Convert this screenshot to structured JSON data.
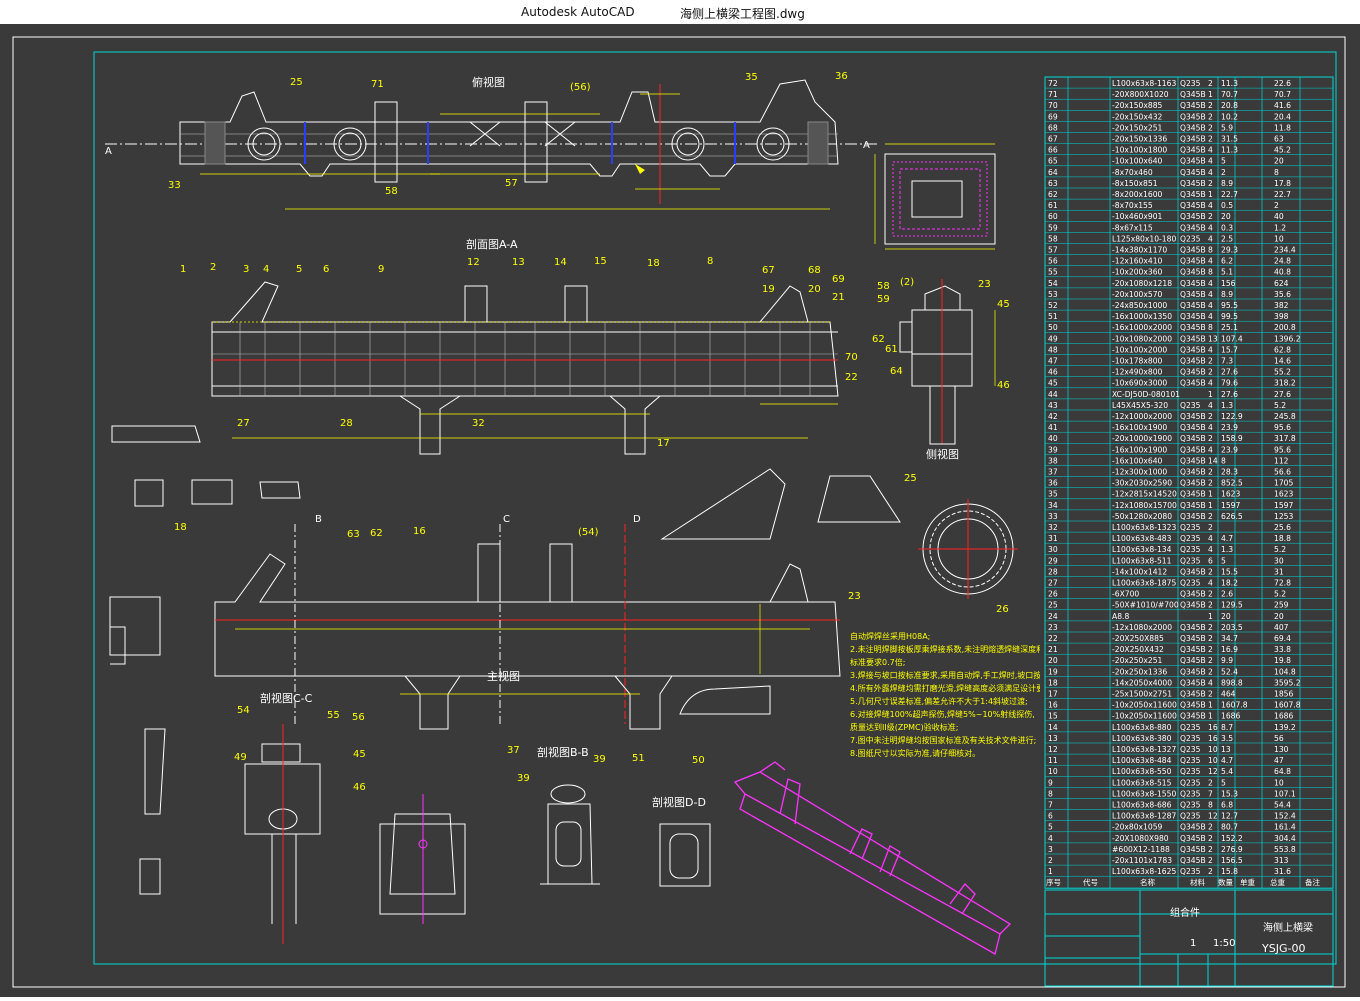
{
  "titlebar": {
    "app": "Autodesk AutoCAD",
    "file": "海侧上横梁工程图.dwg"
  },
  "colors": {
    "background": "#3a3a3a",
    "frame": "#00d8d8",
    "lines": "#ffffff",
    "dims": "#ffff00",
    "leaders": "#19e619",
    "centerline": "#ff2222",
    "hidden": "#2a3cff",
    "iso": "#ff33ff"
  },
  "views": {
    "top": "俯视图",
    "sectionAA": "剖面图A-A",
    "side": "侧视图",
    "front": "主视图",
    "sectionCC": "剖视图C-C",
    "sectionBB": "剖视图B-B",
    "sectionDD": "剖视图D-D"
  },
  "section_letters": [
    "A",
    "A",
    "B",
    "C",
    "D"
  ],
  "top_balloons": [
    "25",
    "71",
    "(56)",
    "35",
    "36",
    "33",
    "58",
    "57"
  ],
  "aa_balloons": [
    "1",
    "2",
    "3",
    "4",
    "5",
    "6",
    "9",
    "12",
    "13",
    "14",
    "15",
    "18",
    "8",
    "67",
    "68",
    "69",
    "19",
    "20",
    "21",
    "70",
    "22",
    "27",
    "28",
    "32",
    "17"
  ],
  "side_balloons": [
    "58",
    "59",
    "61",
    "62",
    "64",
    "(2)",
    "23",
    "45",
    "46"
  ],
  "front_balloons": [
    "18",
    "63",
    "62",
    "16",
    "(54)",
    "23"
  ],
  "misc_balloons": [
    "25",
    "26",
    "54",
    "55",
    "56",
    "49",
    "45",
    "46",
    "37",
    "39",
    "39",
    "51",
    "50"
  ],
  "notes": [
    "自动焊焊丝采用H08A;",
    "2.未注明焊脚按板厚乘焊接系数,未注明熔透焊缝深度和坡口角度按",
    "   标准要求0.7倍;",
    "3.焊接与坡口按标准要求,采用自动焊,手工焊时,坡口按厂标规定;",
    "4.所有外露焊缝均需打磨光滑,焊缝高度必须满足设计要求;",
    "5.几何尺寸误差标准,偏差允许不大于1:4斜坡过渡;",
    "6.对接焊缝100%超声探伤,焊缝5%~10%射线探伤,",
    "   质量达到II级(ZPMC)验收标准;",
    "7.图中未注明焊缝均按国家标准及有关技术文件进行;",
    "8.图纸尺寸以实际为准,请仔细核对。"
  ],
  "bom": [
    [
      "72",
      "L100x63x8-1163",
      "Q235",
      "2",
      "11.3",
      "22.6"
    ],
    [
      "71",
      "-20X800X1020",
      "Q345B",
      "1",
      "70.7",
      "70.7"
    ],
    [
      "70",
      "-20x150x885",
      "Q345B",
      "2",
      "20.8",
      "41.6"
    ],
    [
      "69",
      "-20x150x432",
      "Q345B",
      "2",
      "10.2",
      "20.4"
    ],
    [
      "68",
      "-20x150x251",
      "Q345B",
      "2",
      "5.9",
      "11.8"
    ],
    [
      "67",
      "-20x150x1336",
      "Q345B",
      "2",
      "31.5",
      "63"
    ],
    [
      "66",
      "-10x100x1800",
      "Q345B",
      "4",
      "11.3",
      "45.2"
    ],
    [
      "65",
      "-10x100x640",
      "Q345B",
      "4",
      "5",
      "20"
    ],
    [
      "64",
      "-8x70x460",
      "Q345B",
      "4",
      "2",
      "8"
    ],
    [
      "63",
      "-8x150x851",
      "Q345B",
      "2",
      "8.9",
      "17.8"
    ],
    [
      "62",
      "-8x200x1600",
      "Q345B",
      "1",
      "22.7",
      "22.7"
    ],
    [
      "61",
      "-8x70x155",
      "Q345B",
      "4",
      "0.5",
      "2"
    ],
    [
      "60",
      "-10x460x901",
      "Q345B",
      "2",
      "20",
      "40"
    ],
    [
      "59",
      "-8x67x115",
      "Q345B",
      "4",
      "0.3",
      "1.2"
    ],
    [
      "58",
      "L125x80x10-180",
      "Q235",
      "4",
      "2.5",
      "10"
    ],
    [
      "57",
      "-14x380x1170",
      "Q345B",
      "8",
      "29.3",
      "234.4"
    ],
    [
      "56",
      "-12x160x410",
      "Q345B",
      "4",
      "6.2",
      "24.8"
    ],
    [
      "55",
      "-10x200x360",
      "Q345B",
      "8",
      "5.1",
      "40.8"
    ],
    [
      "54",
      "-20x1080x1218",
      "Q345B",
      "4",
      "156",
      "624"
    ],
    [
      "53",
      "-20x100x570",
      "Q345B",
      "4",
      "8.9",
      "35.6"
    ],
    [
      "52",
      "-24x850x1000",
      "Q345B",
      "4",
      "95.5",
      "382"
    ],
    [
      "51",
      "-16x1000x1350",
      "Q345B",
      "4",
      "99.5",
      "398"
    ],
    [
      "50",
      "-16x1000x2000",
      "Q345B",
      "8",
      "25.1",
      "200.8"
    ],
    [
      "49",
      "-10x1080x2000",
      "Q345B",
      "13",
      "107.4",
      "1396.2"
    ],
    [
      "48",
      "-10x100x2000",
      "Q345B",
      "4",
      "15.7",
      "62.8"
    ],
    [
      "47",
      "-10x178x800",
      "Q345B",
      "2",
      "7.3",
      "14.6"
    ],
    [
      "46",
      "-12x490x800",
      "Q345B",
      "2",
      "27.6",
      "55.2"
    ],
    [
      "45",
      "-10x690x3000",
      "Q345B",
      "4",
      "79.6",
      "318.2"
    ],
    [
      "44",
      "XC-DJ50D-080101",
      "",
      "1",
      "27.6",
      "27.6"
    ],
    [
      "43",
      "L45X45X5-320",
      "Q235",
      "4",
      "1.3",
      "5.2"
    ],
    [
      "42",
      "-12x1000x2000",
      "Q345B",
      "2",
      "122.9",
      "245.8"
    ],
    [
      "41",
      "-16x100x1900",
      "Q345B",
      "4",
      "23.9",
      "95.6"
    ],
    [
      "40",
      "-20x1000x1900",
      "Q345B",
      "2",
      "158.9",
      "317.8"
    ],
    [
      "39",
      "-16x100x1900",
      "Q345B",
      "4",
      "23.9",
      "95.6"
    ],
    [
      "38",
      "-16x100x640",
      "Q345B",
      "14",
      "8",
      "112"
    ],
    [
      "37",
      "-12x300x1000",
      "Q345B",
      "2",
      "28.3",
      "56.6"
    ],
    [
      "36",
      "-30x2030x2590",
      "Q345B",
      "2",
      "852.5",
      "1705"
    ],
    [
      "35",
      "-12x2815x14520",
      "Q345B",
      "1",
      "1623",
      "1623"
    ],
    [
      "34",
      "-12x1080x15700",
      "Q345B",
      "1",
      "1597",
      "1597"
    ],
    [
      "33",
      "-50x1280x2080",
      "Q345B",
      "2",
      "626.5",
      "1253"
    ],
    [
      "32",
      "L100x63x8-1323",
      "Q235",
      "2",
      "",
      "25.6"
    ],
    [
      "31",
      "L100x63x8-483",
      "Q235",
      "4",
      "4.7",
      "18.8"
    ],
    [
      "30",
      "L100x63x8-134",
      "Q235",
      "4",
      "1.3",
      "5.2"
    ],
    [
      "29",
      "L100x63x8-511",
      "Q235",
      "6",
      "5",
      "30"
    ],
    [
      "28",
      "-14x100x1412",
      "Q345B",
      "2",
      "15.5",
      "31"
    ],
    [
      "27",
      "L100x63x8-1875",
      "Q235",
      "4",
      "18.2",
      "72.8"
    ],
    [
      "26",
      "-6X700",
      "Q345B",
      "2",
      "2.6",
      "5.2"
    ],
    [
      "25",
      "-50X#1010/#700",
      "Q345B",
      "2",
      "129.5",
      "259"
    ],
    [
      "24",
      "A8.8",
      "",
      "1",
      "20",
      "20"
    ],
    [
      "23",
      "-12x1080x2000",
      "Q345B",
      "2",
      "203.5",
      "407"
    ],
    [
      "22",
      "-20X250X885",
      "Q345B",
      "2",
      "34.7",
      "69.4"
    ],
    [
      "21",
      "-20X250X432",
      "Q345B",
      "2",
      "16.9",
      "33.8"
    ],
    [
      "20",
      "-20x250x251",
      "Q345B",
      "2",
      "9.9",
      "19.8"
    ],
    [
      "19",
      "-20x250x1336",
      "Q345B",
      "2",
      "52.4",
      "104.8"
    ],
    [
      "18",
      "-14x2050x4000",
      "Q345B",
      "4",
      "898.8",
      "3595.2"
    ],
    [
      "17",
      "-25x1500x2751",
      "Q345B",
      "2",
      "464",
      "1856"
    ],
    [
      "16",
      "-10x2050x11600",
      "Q345B",
      "1",
      "1607.8",
      "1607.8"
    ],
    [
      "15",
      "-10x2050x11600",
      "Q345B",
      "1",
      "1686",
      "1686"
    ],
    [
      "14",
      "L100x63x8-880",
      "Q235",
      "16",
      "8.7",
      "139.2"
    ],
    [
      "13",
      "L100x63x8-380",
      "Q235",
      "16",
      "3.5",
      "56"
    ],
    [
      "12",
      "L100x63x8-1327",
      "Q235",
      "10",
      "13",
      "130"
    ],
    [
      "11",
      "L100x63x8-484",
      "Q235",
      "10",
      "4.7",
      "47"
    ],
    [
      "10",
      "L100x63x8-550",
      "Q235",
      "12",
      "5.4",
      "64.8"
    ],
    [
      "9",
      "L100x63x8-515",
      "Q235",
      "2",
      "5",
      "10"
    ],
    [
      "8",
      "L100x63x8-1550",
      "Q235",
      "7",
      "15.3",
      "107.1"
    ],
    [
      "7",
      "L100x63x8-686",
      "Q235",
      "8",
      "6.8",
      "54.4"
    ],
    [
      "6",
      "L100x63x8-1287",
      "Q235",
      "12",
      "12.7",
      "152.4"
    ],
    [
      "5",
      "-20x80x1059",
      "Q345B",
      "2",
      "80.7",
      "161.4"
    ],
    [
      "4",
      "-20X1080X980",
      "Q345B",
      "2",
      "152.2",
      "304.4"
    ],
    [
      "3",
      "#600X12-1188",
      "Q345B",
      "2",
      "276.9",
      "553.8"
    ],
    [
      "2",
      "-20x1101x1783",
      "Q345B",
      "2",
      "156.5",
      "313"
    ],
    [
      "1",
      "L100x63x8-1625",
      "Q235",
      "2",
      "15.8",
      "31.6"
    ]
  ],
  "bom_header": [
    "序号",
    "代号",
    "名称",
    "材料",
    "数量",
    "单重",
    "总重",
    "备注"
  ],
  "title_block": {
    "assembly": "组合件",
    "part_name": "海侧上横梁",
    "qty": "1",
    "scale": "1:50",
    "drawing_no": "YSJG-00"
  }
}
